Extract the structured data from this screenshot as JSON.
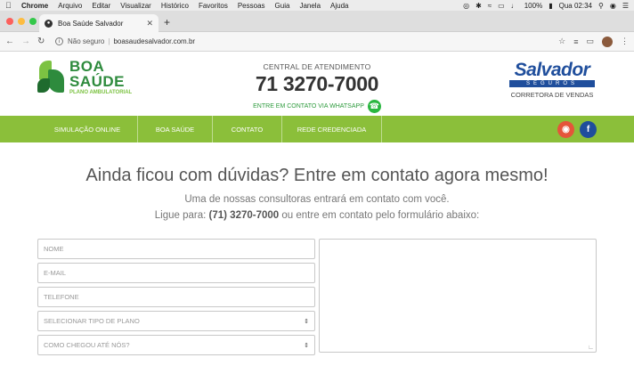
{
  "menubar": {
    "app": "Chrome",
    "items": [
      "Arquivo",
      "Editar",
      "Visualizar",
      "Histórico",
      "Favoritos",
      "Pessoas",
      "Guia",
      "Janela",
      "Ajuda"
    ],
    "battery": "100%",
    "clock": "Qua 02:34"
  },
  "browser": {
    "tab_title": "Boa Saúde Salvador",
    "security": "Não seguro",
    "url": "boasaudesalvador.com.br"
  },
  "header": {
    "logo_line1": "BOA",
    "logo_line2": "SAÚDE",
    "logo_line3": "PLANO AMBULATORIAL",
    "central_label": "CENTRAL DE ATENDIMENTO",
    "phone": "71 3270-7000",
    "whatsapp_label": "ENTRE EM CONTATO VIA WHATSAPP",
    "partner_brand": "Salvador",
    "partner_seg": "SEGUROS",
    "partner_sub": "CORRETORA DE VENDAS"
  },
  "nav": {
    "items": [
      "SIMULAÇÃO ONLINE",
      "BOA SAÚDE",
      "CONTATO",
      "REDE CREDENCIADA"
    ]
  },
  "social": {
    "instagram_color": "#e4553a",
    "facebook_color": "#1f4e9c"
  },
  "content": {
    "headline": "Ainda ficou com dúvidas? Entre em contato agora mesmo!",
    "lead1": "Uma de nossas consultoras entrará em contato com você.",
    "lead2_pre": "Ligue para:",
    "lead2_phone": "(71) 3270-7000",
    "lead2_post": "ou entre em contato pelo formulário abaixo:"
  },
  "form": {
    "nome": "NOME",
    "email": "E-MAIL",
    "telefone": "TELEFONE",
    "tipo_plano": "SELECIONAR TIPO DE PLANO",
    "como_chegou": "COMO CHEGOU ATÉ NÓS?"
  }
}
